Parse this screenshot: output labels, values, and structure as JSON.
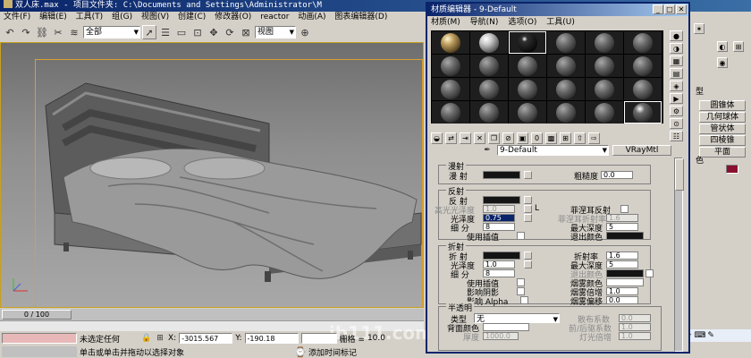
{
  "app": {
    "title": "双人床.max    - 项目文件夹: C:\\Documents and Settings\\Administrator\\M",
    "menu": [
      "文件(F)",
      "编辑(E)",
      "工具(T)",
      "组(G)",
      "视图(V)",
      "创建(C)",
      "修改器(O)",
      "reactor",
      "动画(A)",
      "图表编辑器(D)"
    ]
  },
  "toolbar": {
    "selection_filter": "全部",
    "ref_coord": "视图"
  },
  "viewport": {
    "timeline_label": "0 / 100"
  },
  "status": {
    "selection": "未选定任何",
    "x_label": "X:",
    "x_value": "-3015.567",
    "y_label": "Y:",
    "y_value": "-190.18",
    "grid_label": "栅格 =",
    "grid_value": "10.0",
    "prompt": "单击或单击并拖动以选择对象",
    "add_time_tag": "添加时间标记",
    "watermark": "jb111.com"
  },
  "command_panel": {
    "section_label": "型",
    "buttons": [
      "圆锥体",
      "几何球体",
      "管状体",
      "四棱锥",
      "平面"
    ],
    "color_label": "色",
    "swatch_color": "#8a1030"
  },
  "tray": {
    "items": [
      "中",
      "♪",
      "⊙",
      "✦",
      "⌨",
      "✎"
    ]
  },
  "material_editor": {
    "title": "材质编辑器 - 9-Default",
    "menu": [
      "材质(M)",
      "导航(N)",
      "选项(O)",
      "工具(U)"
    ],
    "material_name": "9-Default",
    "material_type": "VRayMtl",
    "diffuse": {
      "group": "漫射",
      "diffuse_label": "漫  射",
      "roughness_label": "粗糙度",
      "roughness_value": "0.0"
    },
    "reflection": {
      "group": "反射",
      "reflect_label": "反  射",
      "hilight_gloss_label": "高光光泽度",
      "hilight_gloss_value": "1.0",
      "l_button": "L",
      "fresnel_label": "菲涅耳反射",
      "gloss_label": "光泽度",
      "gloss_value": "0.75",
      "fresnel_ior_label": "菲涅耳折射率",
      "fresnel_ior_value": "1.6",
      "subdivs_label": "细  分",
      "subdivs_value": "8",
      "max_depth_label": "最大深度",
      "max_depth_value": "5",
      "use_interp_label": "使用插值",
      "exit_color_label": "退出颜色"
    },
    "refraction": {
      "group": "折射",
      "refract_label": "折  射",
      "ior_label": "折射率",
      "ior_value": "1.6",
      "gloss_label": "光泽度",
      "gloss_value": "1.0",
      "max_depth_label": "最大深度",
      "max_depth_value": "5",
      "subdivs_label": "细  分",
      "subdivs_value": "8",
      "exit_color_label": "退出颜色",
      "use_interp_label": "使用插值",
      "fog_color_label": "烟雾颜色",
      "affect_shadows_label": "影响阴影",
      "fog_mult_label": "烟雾倍增",
      "fog_mult_value": "1.0",
      "affect_alpha_label": "影响 Alpha",
      "fog_bias_label": "烟雾偏移",
      "fog_bias_value": "0.0"
    },
    "translucency": {
      "group": "半透明",
      "type_label": "类型",
      "type_value": "无",
      "back_color_label": "背面颜色",
      "scatter_coeff_label": "散布系数",
      "scatter_coeff_value": "0.0",
      "fwd_back_label": "前/后驱系数",
      "fwd_back_value": "1.0",
      "thickness_label": "厚度",
      "thickness_value": "1000.0",
      "light_mult_label": "灯光倍增",
      "light_mult_value": "1.0"
    }
  }
}
